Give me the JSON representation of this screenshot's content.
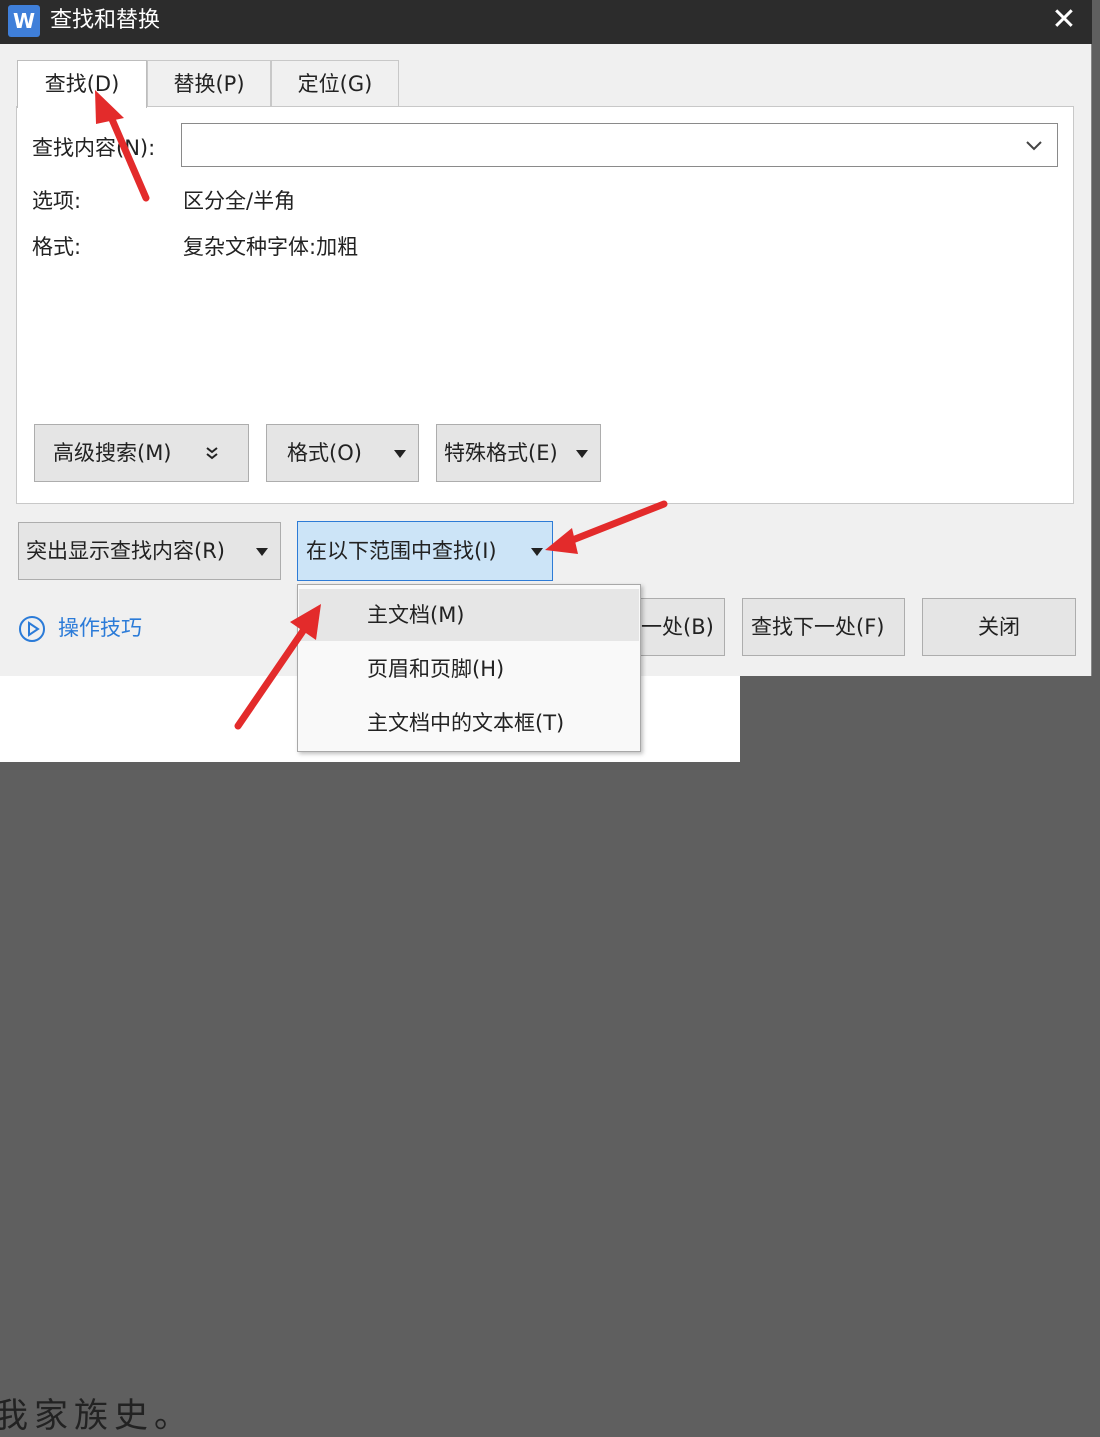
{
  "window": {
    "app_icon": "W",
    "title": "查找和替换",
    "close": "✕"
  },
  "tabs": [
    {
      "label": "查找(D)",
      "active": true
    },
    {
      "label": "替换(P)",
      "active": false
    },
    {
      "label": "定位(G)",
      "active": false
    }
  ],
  "find": {
    "label": "查找内容(N):",
    "value": "",
    "options_label": "选项:",
    "options_value": "区分全/半角",
    "format_label": "格式:",
    "format_value": "复杂文种字体:加粗"
  },
  "panel_buttons": {
    "advanced": "高级搜索(M)",
    "format": "格式(O)",
    "special": "特殊格式(E)"
  },
  "bottom_buttons": {
    "highlight": "突出显示查找内容(R)",
    "find_in": "在以下范围中查找(I)",
    "find_prev": "一处(B)",
    "find_next": "查找下一处(F)",
    "close": "关闭"
  },
  "tips": {
    "label": "操作技巧"
  },
  "find_in_menu": [
    {
      "label": "主文档(M)",
      "highlighted": true
    },
    {
      "label": "页眉和页脚(H)",
      "highlighted": false
    },
    {
      "label": "主文档中的文本框(T)",
      "highlighted": false
    }
  ],
  "document": {
    "text": "我家族史。"
  },
  "colors": {
    "titlebar": "#2c2c2c",
    "accent": "#2b7bd8",
    "annotation_arrow": "#e32b2b",
    "focused_button": "#cce4f7"
  },
  "icons": [
    "app-logo-icon",
    "close-icon",
    "chevron-down-icon",
    "play-circle-icon",
    "double-chevron-down-icon",
    "caret-down-icon"
  ]
}
